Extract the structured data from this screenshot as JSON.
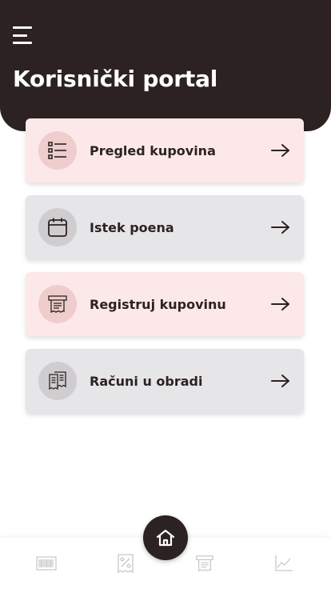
{
  "header": {
    "title": "Korisnički portal",
    "menu_icon": "hamburger-menu-icon"
  },
  "menu_cards": [
    {
      "label": "Pregled kupovina",
      "icon": "list-icon",
      "tone": "pink"
    },
    {
      "label": "Istek poena",
      "icon": "calendar-icon",
      "tone": "gray"
    },
    {
      "label": "Registruj kupovinu",
      "icon": "receipt-scan-icon",
      "tone": "pink"
    },
    {
      "label": "Računi u obradi",
      "icon": "receipts-icon",
      "tone": "gray"
    }
  ],
  "bottom_nav": {
    "items": [
      "barcode-icon",
      "percent-tag-icon",
      "home-icon",
      "receipt-scan-icon",
      "chart-icon"
    ],
    "active": "home-icon"
  },
  "colors": {
    "header_bg": "#2c2221",
    "card_pink": "#fde8e9",
    "card_gray": "#e6e5e8",
    "icon_circle_pink": "#efcdcd",
    "icon_circle_gray": "#cfcdd0",
    "text_dark": "#2c2221",
    "nav_icon_inactive": "#c9c6ca"
  }
}
